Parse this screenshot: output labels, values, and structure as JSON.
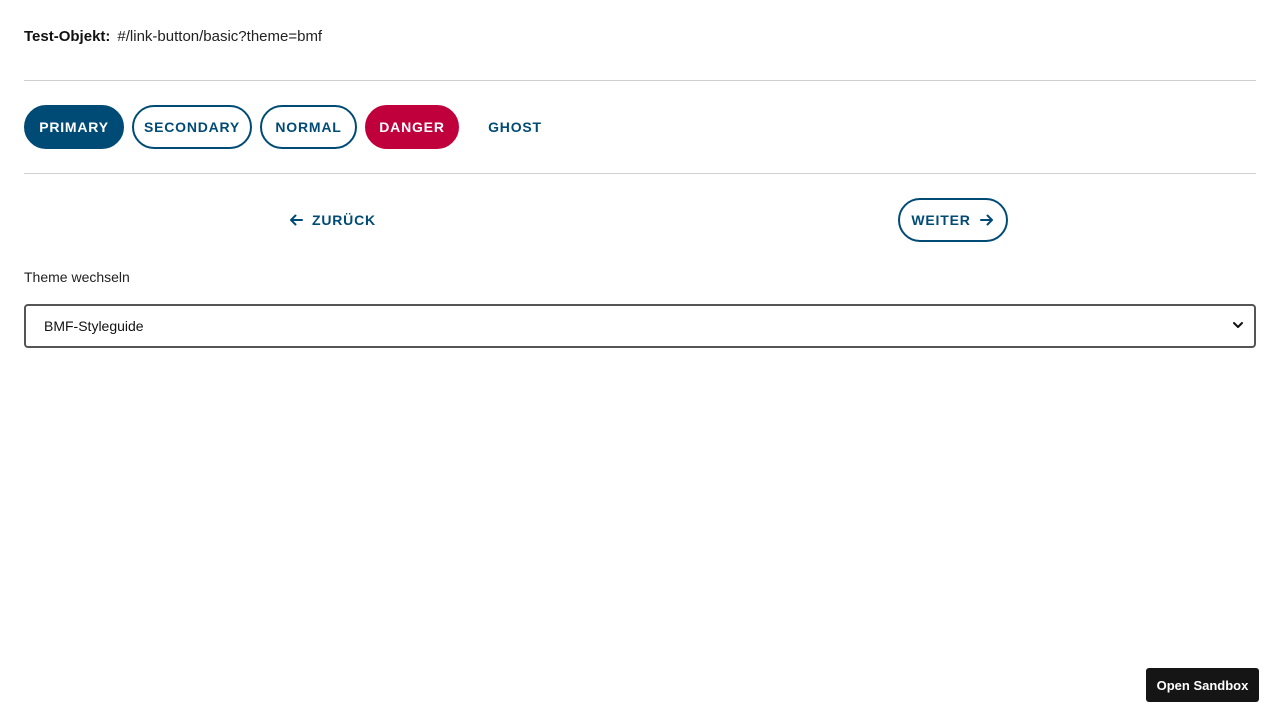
{
  "test_object": {
    "label": "Test-Objekt:",
    "value": "#/link-button/basic?theme=bmf"
  },
  "buttons": [
    {
      "label": "PRIMARY",
      "variant": "primary"
    },
    {
      "label": "SECONDARY",
      "variant": "secondary"
    },
    {
      "label": "NORMAL",
      "variant": "normal"
    },
    {
      "label": "DANGER",
      "variant": "danger"
    },
    {
      "label": "GHOST",
      "variant": "ghost"
    }
  ],
  "navigation": {
    "back_label": "ZURÜCK",
    "back_icon": "arrow-left-icon",
    "next_label": "WEITER",
    "next_icon": "arrow-right-icon"
  },
  "theme": {
    "label": "Theme wechseln",
    "selected": "BMF-Styleguide",
    "dropdown_icon": "chevron-down-icon"
  },
  "sandbox": {
    "label": "Open Sandbox"
  },
  "colors": {
    "primary": "#004b76",
    "danger": "#c0003c",
    "divider": "#cfcfcf",
    "sandbox_bg": "#151515"
  }
}
